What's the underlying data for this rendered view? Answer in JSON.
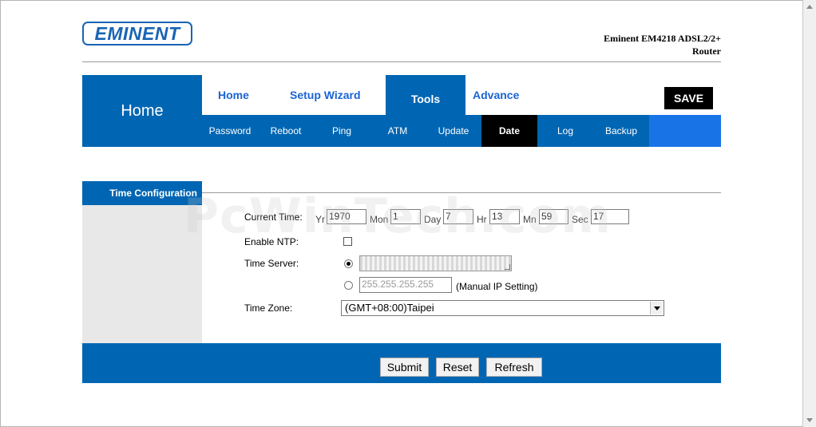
{
  "brand": {
    "logo_text": "EMINENT",
    "model_line1": "Eminent EM4218 ADSL2/2+",
    "model_line2": "Router",
    "accent": "#0066b3"
  },
  "nav": {
    "section_title": "Home",
    "tabs": [
      {
        "label": "Home"
      },
      {
        "label": "Setup Wizard"
      },
      {
        "label": "Tools"
      },
      {
        "label": "Advance"
      }
    ],
    "save_label": "SAVE",
    "subtabs": [
      {
        "label": "Password"
      },
      {
        "label": "Reboot"
      },
      {
        "label": "Ping"
      },
      {
        "label": "ATM"
      },
      {
        "label": "Update"
      },
      {
        "label": "Date"
      },
      {
        "label": "Log"
      },
      {
        "label": "Backup"
      }
    ]
  },
  "sidebar": {
    "title": "Time Configuration"
  },
  "form": {
    "current_time_label": "Current Time:",
    "yr_label": "Yr",
    "yr_value": "1970",
    "mon_label": "Mon",
    "mon_value": "1",
    "day_label": "Day",
    "day_value": "7",
    "hr_label": "Hr",
    "hr_value": "13",
    "mn_label": "Mn",
    "mn_value": "59",
    "sec_label": "Sec",
    "sec_value": "17",
    "enable_ntp_label": "Enable NTP:",
    "time_server_label": "Time Server:",
    "manual_ip_value": "255.255.255.255",
    "manual_ip_note": "(Manual IP Setting)",
    "time_zone_label": "Time Zone:",
    "time_zone_value": "(GMT+08:00)Taipei"
  },
  "buttons": {
    "submit": "Submit",
    "reset": "Reset",
    "refresh": "Refresh"
  },
  "watermark": "PcWinTech.com"
}
